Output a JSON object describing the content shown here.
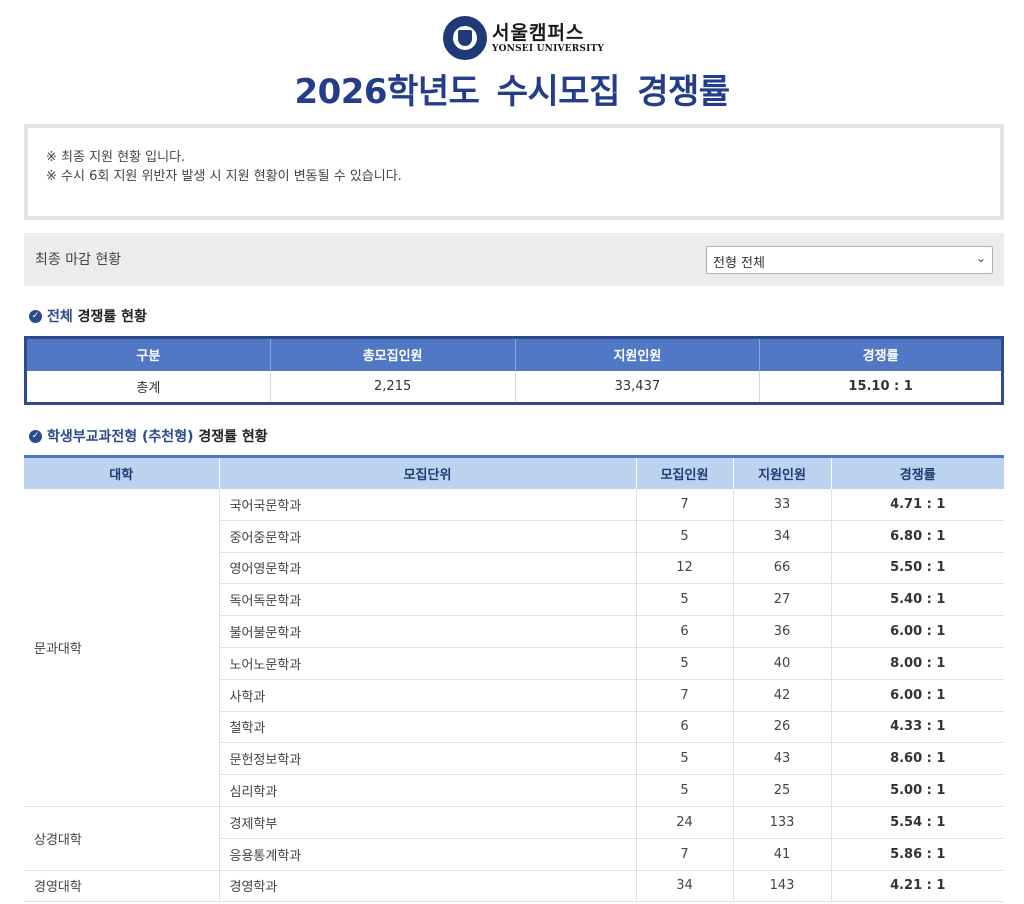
{
  "header": {
    "logo_kr": "서울캠퍼스",
    "logo_en": "YONSEI UNIVERSITY",
    "title": "2026학년도 수시모집 경쟁률"
  },
  "notice": {
    "lines": [
      "※ 최종 지원 현황 입니다.",
      "※ 수시 6회 지원 위반자 발생 시 지원 현황이 변동될 수 있습니다."
    ]
  },
  "filter": {
    "label": "최종 마감 현황",
    "selected": "전형 전체"
  },
  "overall": {
    "title_highlight": "전체",
    "title_rest": " 경쟁률 현황",
    "headers": [
      "구분",
      "총모집인원",
      "지원인원",
      "경쟁률"
    ],
    "row": [
      "총계",
      "2,215",
      "33,437",
      "15.10 : 1"
    ]
  },
  "detail": {
    "title_highlight": "학생부교과전형 (추천형)",
    "title_rest": " 경쟁률 현황",
    "headers": [
      "대학",
      "모집단위",
      "모집인원",
      "지원인원",
      "경쟁률"
    ],
    "groups": [
      {
        "college": "문과대학",
        "rows": [
          [
            "국어국문학과",
            "7",
            "33",
            "4.71 : 1"
          ],
          [
            "중어중문학과",
            "5",
            "34",
            "6.80 : 1"
          ],
          [
            "영어영문학과",
            "12",
            "66",
            "5.50 : 1"
          ],
          [
            "독어독문학과",
            "5",
            "27",
            "5.40 : 1"
          ],
          [
            "불어불문학과",
            "6",
            "36",
            "6.00 : 1"
          ],
          [
            "노어노문학과",
            "5",
            "40",
            "8.00 : 1"
          ],
          [
            "사학과",
            "7",
            "42",
            "6.00 : 1"
          ],
          [
            "철학과",
            "6",
            "26",
            "4.33 : 1"
          ],
          [
            "문헌정보학과",
            "5",
            "43",
            "8.60 : 1"
          ],
          [
            "심리학과",
            "5",
            "25",
            "5.00 : 1"
          ]
        ]
      },
      {
        "college": "상경대학",
        "rows": [
          [
            "경제학부",
            "24",
            "133",
            "5.54 : 1"
          ],
          [
            "응용통계학과",
            "7",
            "41",
            "5.86 : 1"
          ]
        ]
      },
      {
        "college": "경영대학",
        "rows": [
          [
            "경영학과",
            "34",
            "143",
            "4.21 : 1"
          ]
        ]
      }
    ]
  }
}
